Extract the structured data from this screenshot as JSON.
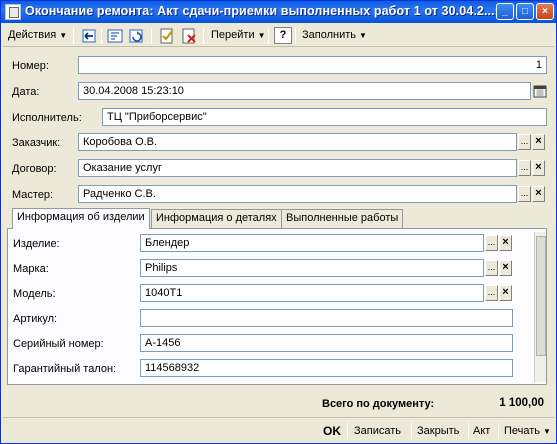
{
  "window": {
    "title": "Окончание ремонта: Акт сдачи-приемки выполненных работ 1 от 30.04.2...:10",
    "controls": [
      "_",
      "□",
      "×"
    ]
  },
  "toolbar": {
    "actions_label": "Действия",
    "goto_label": "Перейти",
    "fill_label": "Заполнить",
    "help_label": "?"
  },
  "form": {
    "number_label": "Номер:",
    "number_value": "1",
    "date_label": "Дата:",
    "date_value": "30.04.2008 15:23:10",
    "executor_label": "Исполнитель:",
    "executor_value": "ТЦ \"Приборсервис\"",
    "customer_label": "Заказчик:",
    "customer_value": "Коробова О.В.",
    "contract_label": "Договор:",
    "contract_value": "Оказание услуг",
    "master_label": "Мастер:",
    "master_value": "Радченко С.В."
  },
  "tabs": [
    {
      "label": "Информация об изделии"
    },
    {
      "label": "Информация о деталях"
    },
    {
      "label": "Выполненные работы"
    }
  ],
  "product": {
    "item_label": "Изделие:",
    "item_value": "Блендер",
    "brand_label": "Марка:",
    "brand_value": "Philips",
    "model_label": "Модель:",
    "model_value": "1040T1",
    "article_label": "Артикул:",
    "article_value": "",
    "serial_label": "Серийный номер:",
    "serial_value": "A-1456",
    "warranty_label": "Гарантийный талон:",
    "warranty_value": "114568932"
  },
  "footer": {
    "total_label": "Всего по документу:",
    "total_value": "1 100,00",
    "buttons": {
      "ok": "OK",
      "save": "Записать",
      "close": "Закрыть",
      "act": "Акт",
      "print": "Печать"
    }
  },
  "icons": {
    "ellipsis": "...",
    "clear": "×",
    "dropdown": "▼"
  }
}
